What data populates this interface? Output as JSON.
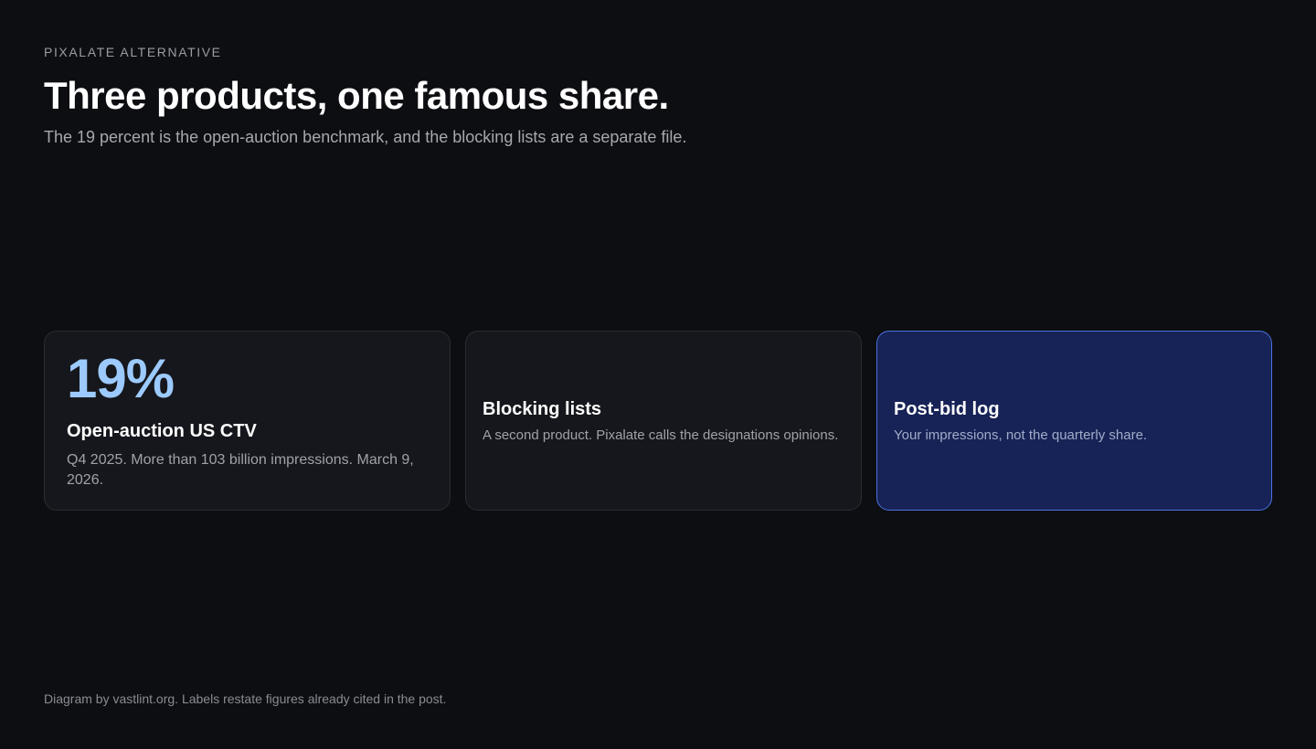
{
  "header": {
    "eyebrow": "PIXALATE ALTERNATIVE",
    "title": "Three products, one famous share.",
    "subtitle": "The 19 percent is the open-auction benchmark, and the blocking lists are a separate file."
  },
  "cards": [
    {
      "stat": "19%",
      "title": "Open-auction US CTV",
      "body": "Q4 2025. More than 103 billion impressions. March 9, 2026."
    },
    {
      "title": "Blocking lists",
      "body": "A second product. Pixalate calls the designations opinions."
    },
    {
      "title": "Post-bid log",
      "body": "Your impressions, not the quarterly share.",
      "highlighted": true
    }
  ],
  "footer": {
    "note": "Diagram by vastlint.org. Labels restate figures already cited in the post."
  },
  "colors": {
    "background": "#0d0e12",
    "stat_accent": "#9ccaff",
    "highlight_card": "#172356",
    "highlight_border": "#4a72e0"
  }
}
